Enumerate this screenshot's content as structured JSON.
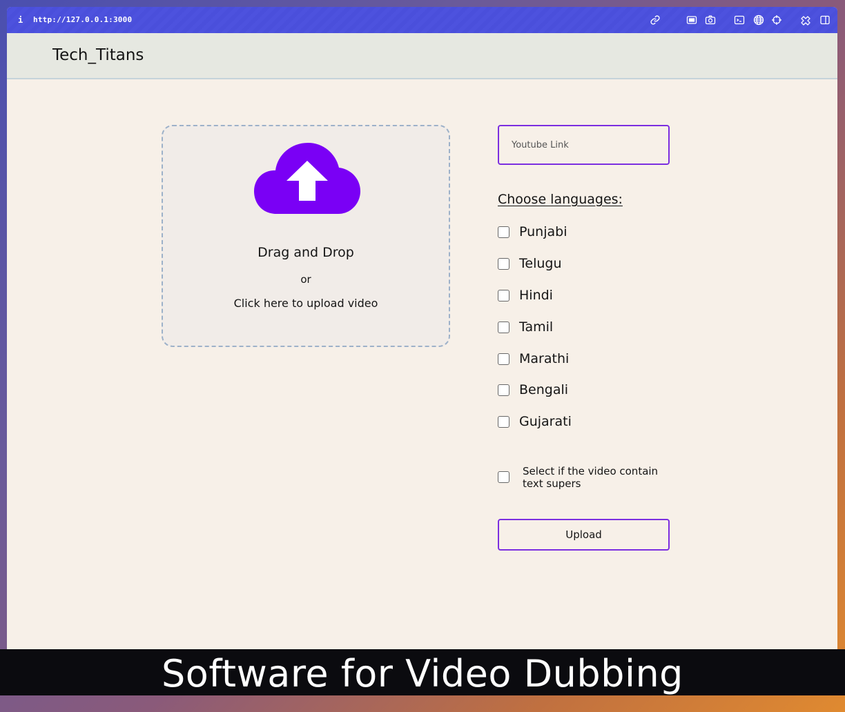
{
  "browser": {
    "info": "i",
    "url": "http://127.0.0.1:3000",
    "icons": [
      "link-icon",
      "screenshot-icon",
      "camera-icon",
      "terminal-icon",
      "globe-icon",
      "crosshair-icon",
      "extensions-icon",
      "sidebar-icon"
    ]
  },
  "header": {
    "brand": "Tech_Titans"
  },
  "dropzone": {
    "icon": "cloud-upload-icon",
    "title": "Drag and Drop",
    "or": "or",
    "click": "Click here to upload video"
  },
  "form": {
    "youtube_placeholder": "Youtube Link",
    "languages_title": "Choose languages:",
    "languages": [
      {
        "label": "Punjabi",
        "checked": false
      },
      {
        "label": "Telugu",
        "checked": false
      },
      {
        "label": "Hindi",
        "checked": false
      },
      {
        "label": "Tamil",
        "checked": false
      },
      {
        "label": "Marathi",
        "checked": false
      },
      {
        "label": "Bengali",
        "checked": false
      },
      {
        "label": "Gujarati",
        "checked": false
      }
    ],
    "supers_label": "Select if the video contain text supers",
    "supers_checked": false,
    "upload_label": "Upload"
  },
  "caption": "Software for Video Dubbing",
  "colors": {
    "accent": "#7b2ee0",
    "cloud": "#7a00f5",
    "browser_bar": "#4a4fdb"
  }
}
